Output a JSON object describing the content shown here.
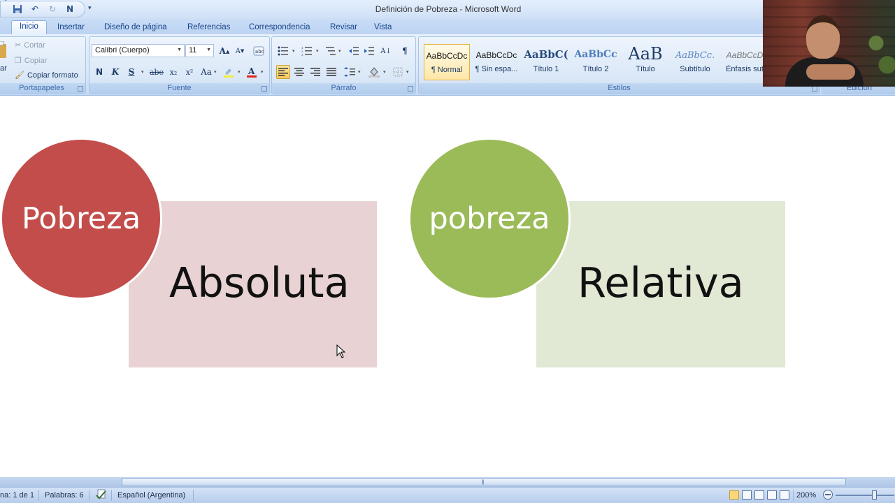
{
  "window": {
    "title": "Definición de Pobreza - Microsoft Word"
  },
  "qat": {
    "more": "▾"
  },
  "tabs": [
    "Inicio",
    "Insertar",
    "Diseño de página",
    "Referencias",
    "Correspondencia",
    "Revisar",
    "Vista"
  ],
  "clipboard": {
    "cut": "Cortar",
    "copy": "Copiar",
    "format_painter": "Copiar formato",
    "paste_fragment": "ar",
    "label": "Portapapeles"
  },
  "font": {
    "name": "Calibri (Cuerpo)",
    "size": "11",
    "label": "Fuente",
    "bold": "N",
    "italic": "K",
    "underline": "S",
    "strike": "abe",
    "subscript": "x₂",
    "superscript": "x²",
    "change_case": "Aa",
    "grow": "A",
    "shrink": "A"
  },
  "paragraph": {
    "label": "Párrafo",
    "pilcrow": "¶"
  },
  "styles": {
    "label": "Estilos",
    "items": [
      {
        "sample": "AaBbCcDc",
        "name": "¶ Normal"
      },
      {
        "sample": "AaBbCcDc",
        "name": "¶ Sin espa..."
      },
      {
        "sample": "AaBbC(",
        "name": "Título 1"
      },
      {
        "sample": "AaBbCc",
        "name": "Título 2"
      },
      {
        "sample": "AaB",
        "name": "Título"
      },
      {
        "sample": "AaBbCc.",
        "name": "Subtítulo"
      },
      {
        "sample": "AaBbCcD",
        "name": "Énfasis sut"
      }
    ]
  },
  "editing": {
    "label": "Edición"
  },
  "document": {
    "circle_left": "Pobreza",
    "rect_left": "Absoluta",
    "circle_right": "pobreza",
    "rect_right": "Relativa"
  },
  "status": {
    "page": "na: 1 de 1",
    "words": "Palabras: 6",
    "language": "Español (Argentina)",
    "zoom": "200%"
  },
  "colors": {
    "circle_red": "#c24d4a",
    "circle_green": "#9bbb59",
    "rect_pink": "#e8d2d3",
    "rect_green": "#e1e8d4"
  }
}
